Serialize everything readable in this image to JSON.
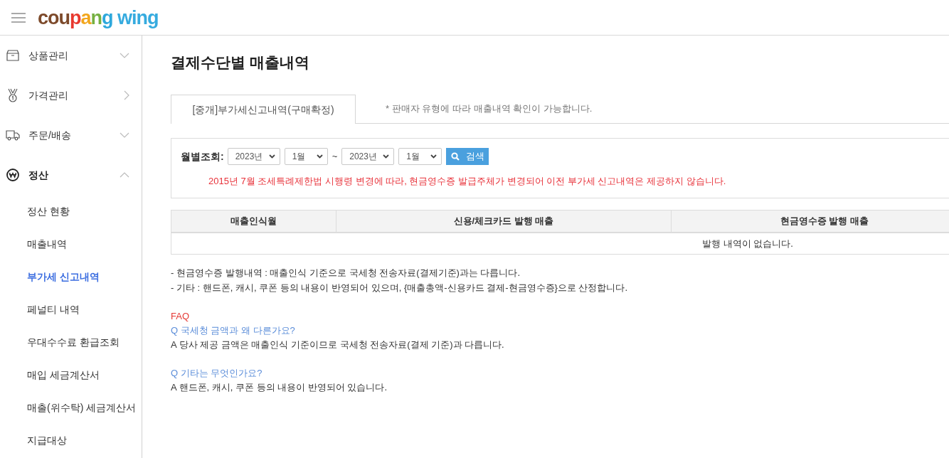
{
  "header": {
    "logo": "coupang wing"
  },
  "sidebar": {
    "groups": [
      {
        "label": "상품관리",
        "kind": "menu",
        "expanded": false,
        "selected": false
      },
      {
        "label": "가격관리",
        "kind": "link",
        "selected": false
      },
      {
        "label": "주문/배송",
        "kind": "menu",
        "expanded": false,
        "selected": false
      },
      {
        "label": "정산",
        "kind": "menu",
        "expanded": true,
        "selected": true,
        "children": [
          {
            "label": "정산 현황",
            "selected": false
          },
          {
            "label": "매출내역",
            "selected": false
          },
          {
            "label": "부가세 신고내역",
            "selected": true
          },
          {
            "label": "페널티 내역",
            "selected": false
          },
          {
            "label": "우대수수료 환급조회",
            "selected": false
          },
          {
            "label": "매입 세금계산서",
            "selected": false
          },
          {
            "label": "매출(위수탁) 세금계산서",
            "selected": false
          },
          {
            "label": "지급대상",
            "selected": false
          }
        ]
      }
    ]
  },
  "page": {
    "title": "결제수단별 매출내역"
  },
  "tabs": [
    {
      "label": "[중개]부가세신고내역(구매확정)",
      "selected": true
    }
  ],
  "tab_note": "* 판매자 유형에 따라 매출내역 확인이 가능합니다.",
  "filter": {
    "label": "월별조회:",
    "from": [
      {
        "kind": "year",
        "value": "2023년"
      },
      {
        "kind": "month",
        "value": "1월"
      }
    ],
    "separator": "~",
    "to": [
      {
        "kind": "year",
        "value": "2023년"
      },
      {
        "kind": "month",
        "value": "1월"
      }
    ],
    "search_button": "검색",
    "notice": "2015년 7월 조세특례제한법 시행령 변경에 따라, 현금영수증 발급주체가 변경되어 이전 부가세 신고내역은 제공하지 않습니다."
  },
  "table": {
    "columns": [
      "매출인식월",
      "신용/체크카드 발행 매출",
      "현금영수증 발행 매출"
    ],
    "empty_message": "발행 내역이 없습니다."
  },
  "notes": [
    "- 현금영수증 발행내역 : 매출인식 기준으로 국세청 전송자료(결제기준)과는 다릅니다.",
    "- 기타 : 핸드폰, 캐시, 쿠폰 등의 내용이 반영되어 있으며, {매출총액-신용카드 결제-현금영수증}으로 산정합니다."
  ],
  "faq": {
    "title": "FAQ",
    "items": [
      {
        "question": "Q 국세청 금액과 왜 다른가요?",
        "answer": "A 당사 제공 금액은 매출인식 기준이므로 국세청 전송자료(결제 기준)과 다릅니다."
      },
      {
        "question": "Q 기타는 무엇인가요?",
        "answer": "A 핸드폰, 캐시, 쿠폰 등의 내용이 반영되어 있습니다."
      }
    ]
  }
}
